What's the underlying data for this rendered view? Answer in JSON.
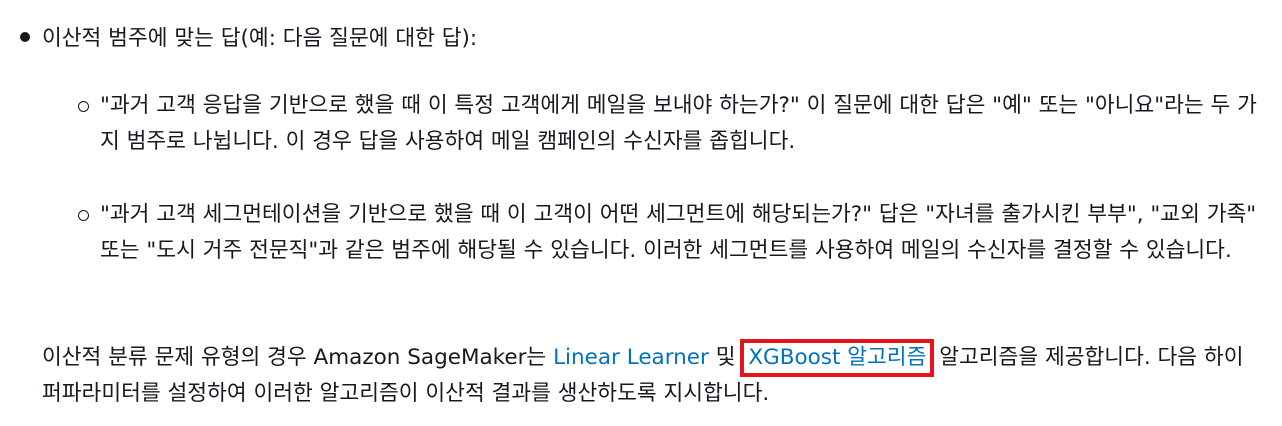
{
  "bullet": {
    "text": "이산적 범주에 맞는 답(예: 다음 질문에 대한 답):"
  },
  "subitems": [
    {
      "text": "\"과거 고객 응답을 기반으로 했을 때 이 특정 고객에게 메일을 보내야 하는가?\" 이 질문에 대한 답은 \"예\" 또는 \"아니요\"라는 두 가지 범주로 나뉩니다. 이 경우 답을 사용하여 메일 캠페인의 수신자를 좁힙니다."
    },
    {
      "text": "\"과거 고객 세그먼테이션을 기반으로 했을 때 이 고객이 어떤 세그먼트에 해당되는가?\" 답은 \"자녀를 출가시킨 부부\", \"교외 가족\" 또는 \"도시 거주 전문직\"과 같은 범주에 해당될 수 있습니다. 이러한 세그먼트를 사용하여 메일의 수신자를 결정할 수 있습니다."
    }
  ],
  "paragraph": {
    "before": "이산적 분류 문제 유형의 경우 Amazon SageMaker는 ",
    "link1": "Linear Learner",
    "middle": " 및 ",
    "link2": "XGBoost 알고리즘",
    "after": " 알고리즘을 제공합니다. 다음 하이퍼파라미터를 설정하여 이러한 알고리즘이 이산적 결과를 생산하도록 지시합니다."
  }
}
